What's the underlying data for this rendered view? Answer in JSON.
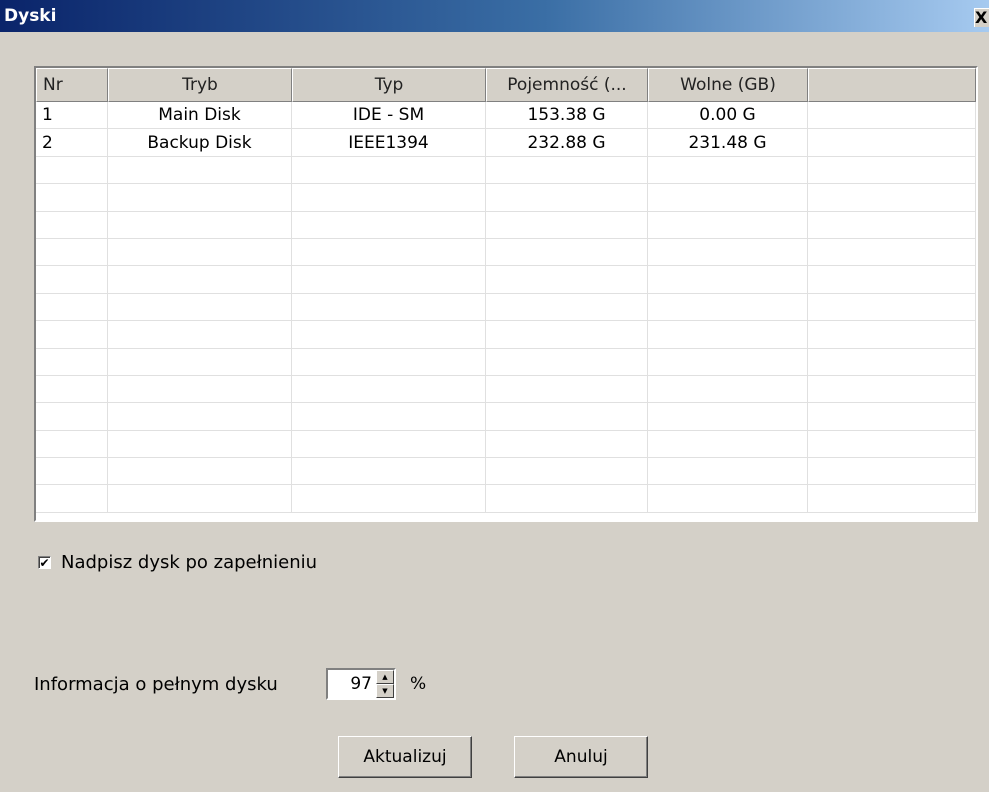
{
  "window": {
    "title": "Dyski",
    "close_label": "X"
  },
  "table": {
    "columns": [
      "Nr",
      "Tryb",
      "Typ",
      "Pojemność (...",
      "Wolne (GB)",
      ""
    ],
    "rows": [
      [
        "1",
        "Main Disk",
        "IDE - SM",
        "153.38 G",
        "0.00 G",
        ""
      ],
      [
        "2",
        "Backup Disk",
        "IEEE1394",
        "232.88 G",
        "231.48 G",
        ""
      ]
    ],
    "empty_rows": 13
  },
  "overwrite": {
    "checked": true,
    "check_mark": "✔",
    "label": "Nadpisz dysk po zapełnieniu"
  },
  "full_disk": {
    "label": "Informacja o pełnym dysku",
    "value": "97",
    "unit": "%"
  },
  "buttons": {
    "update": "Aktualizuj",
    "cancel": "Anuluj"
  }
}
